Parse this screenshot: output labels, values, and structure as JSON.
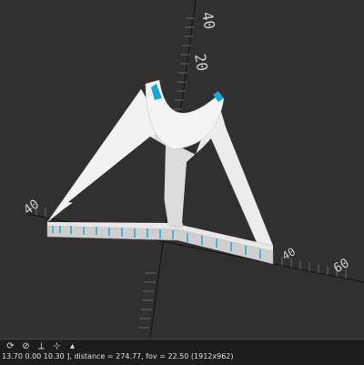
{
  "viewport": {
    "axis_labels": {
      "y_top": "40",
      "y_mid": "20",
      "x_left": "40",
      "x_right_60": "60",
      "x_right_40": "40"
    },
    "colors": {
      "background": "#303030",
      "model": "#f0f0f0",
      "model_shade": "#c8c8c8",
      "highlight": "#1aa6d0",
      "axis": "#111111"
    }
  },
  "toolbar": {
    "icons": [
      "view-all-icon",
      "reset-view-icon",
      "axes-icon",
      "crosshair-icon",
      "scale-marker-icon"
    ]
  },
  "status": {
    "text": "13.70 0.00 10.30 ], distance = 274.77, fov = 22.50 (1912x962)"
  }
}
